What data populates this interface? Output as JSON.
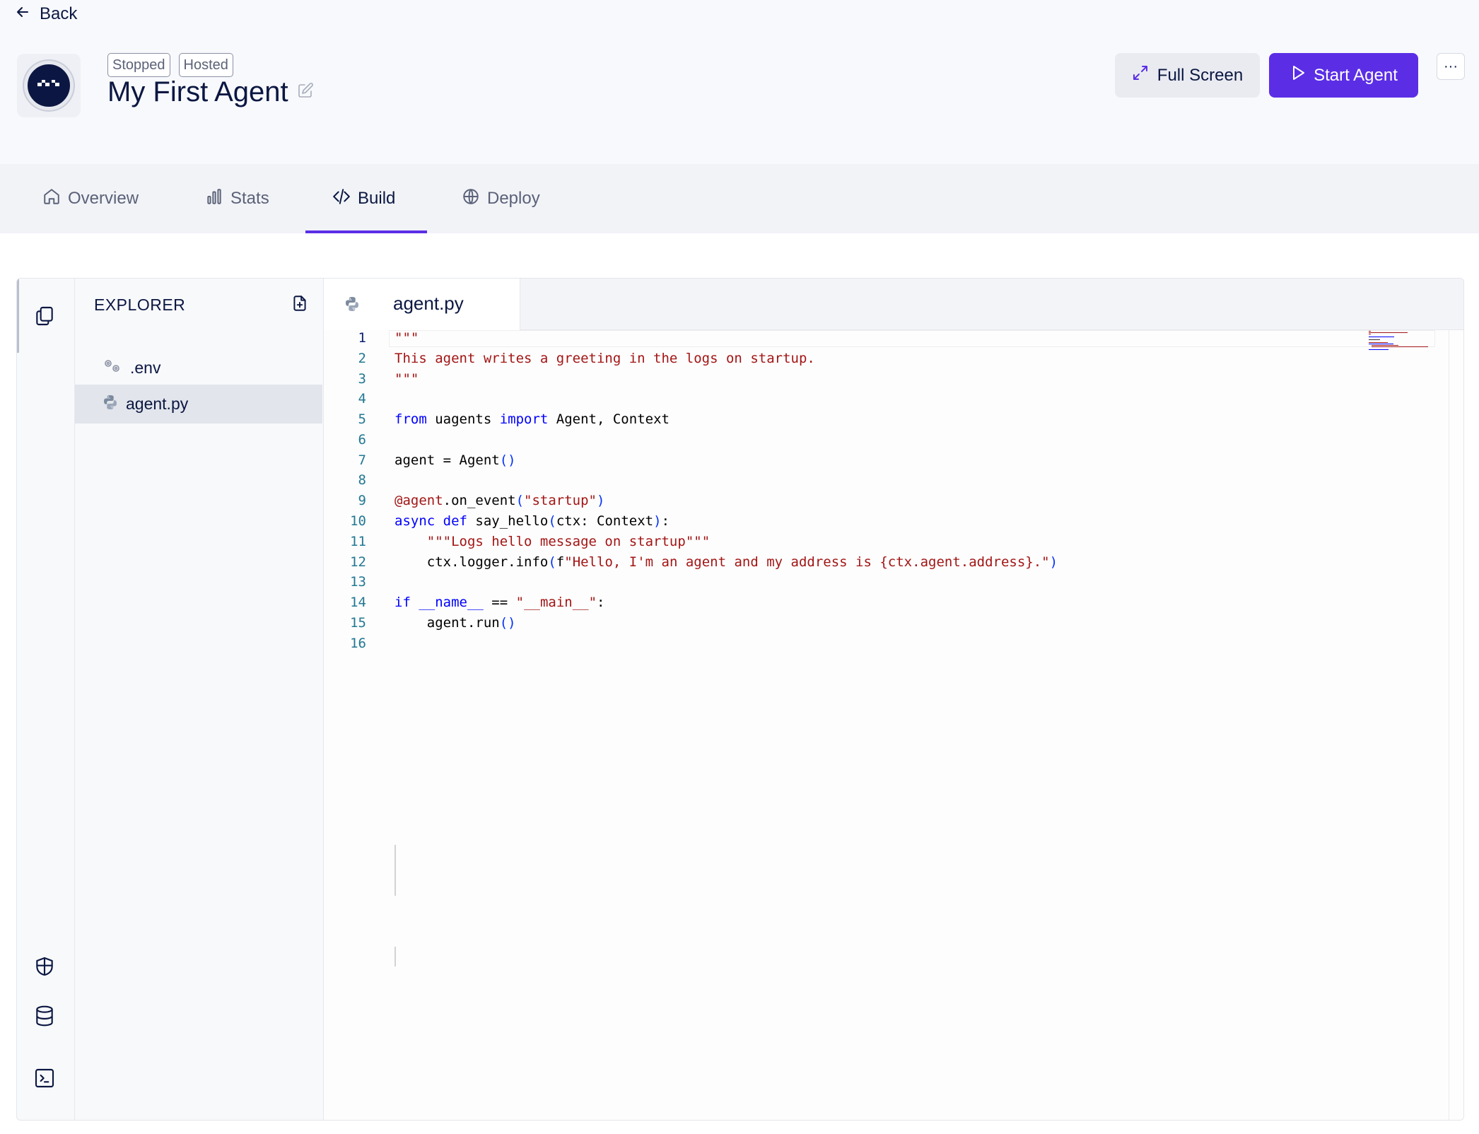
{
  "header": {
    "back_label": "Back",
    "badges": [
      "Stopped",
      "Hosted"
    ],
    "title": "My First Agent",
    "full_screen_label": "Full Screen",
    "start_label": "Start Agent",
    "more_label": "···",
    "accent_color": "#5b2ee6"
  },
  "tabs": [
    {
      "label": "Overview",
      "icon": "home-icon"
    },
    {
      "label": "Stats",
      "icon": "bar-chart-icon"
    },
    {
      "label": "Build",
      "icon": "code-icon",
      "active": true
    },
    {
      "label": "Deploy",
      "icon": "globe-icon"
    }
  ],
  "explorer": {
    "title": "EXPLORER",
    "files": [
      {
        "name": ".env",
        "icon": "settings-gears-icon"
      },
      {
        "name": "agent.py",
        "icon": "python-icon",
        "selected": true
      }
    ]
  },
  "editor": {
    "open_tab": "agent.py",
    "line_numbers": [
      "1",
      "2",
      "3",
      "4",
      "5",
      "6",
      "7",
      "8",
      "9",
      "10",
      "11",
      "12",
      "13",
      "14",
      "15",
      "16"
    ],
    "lines": [
      "\"\"\"",
      "This agent writes a greeting in the logs on startup.",
      "\"\"\"",
      "",
      "from uagents import Agent, Context",
      "",
      "agent = Agent()",
      "",
      "@agent.on_event(\"startup\")",
      "async def say_hello(ctx: Context):",
      "    \"\"\"Logs hello message on startup\"\"\"",
      "    ctx.logger.info(f\"Hello, I'm an agent and my address is {ctx.agent.address}.\")",
      "",
      "if __name__ == \"__main__\":",
      "    agent.run()",
      ""
    ]
  },
  "activity_bar": [
    "files-icon",
    "shield-icon",
    "database-icon",
    "terminal-icon"
  ]
}
